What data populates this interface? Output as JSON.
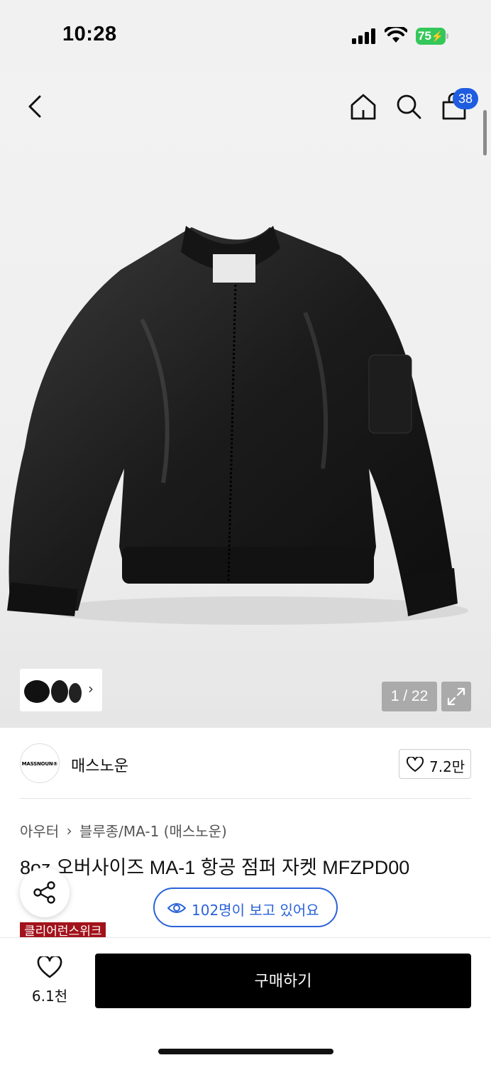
{
  "status_bar": {
    "time": "10:28",
    "battery": "75"
  },
  "header": {
    "icons": [
      "back-icon",
      "home-icon",
      "search-icon",
      "shopping-bag-icon"
    ],
    "cart_badge": "38"
  },
  "gallery": {
    "counter": "1 / 22",
    "thumb_arrow": "›"
  },
  "brand": {
    "logo_text": "MASSNOUN®",
    "name": "매스노운",
    "like_count": "7.2만"
  },
  "breadcrumb": {
    "category": "아우터",
    "separator": "›",
    "subcategory": "블루종/MA-1 (매스노운)"
  },
  "product": {
    "title": "8oz 오버사이즈 MA-1 항공 점퍼 자켓 MFZPD00",
    "tag": "클리어런스위크"
  },
  "viewers": {
    "text": "102명이 보고 있어요"
  },
  "bottom_bar": {
    "wish_count": "6.1천",
    "buy_label": "구매하기"
  },
  "colors": {
    "accent_blue": "#2a62d8",
    "badge_blue": "#1f5de0",
    "battery_green": "#34c759",
    "tag_red": "#a2121b"
  }
}
